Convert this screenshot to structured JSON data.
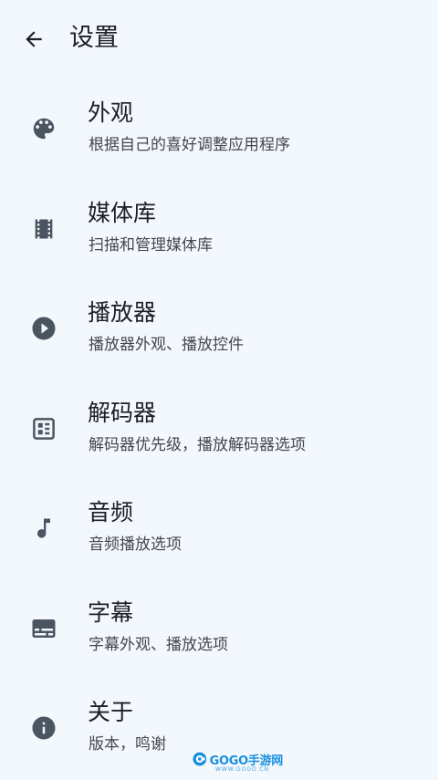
{
  "header": {
    "title": "设置",
    "back_icon": "arrow-back-icon"
  },
  "items": [
    {
      "title": "外观",
      "subtitle": "根据自己的喜好调整应用程序",
      "icon": "palette-icon"
    },
    {
      "title": "媒体库",
      "subtitle": "扫描和管理媒体库",
      "icon": "film-strip-icon"
    },
    {
      "title": "播放器",
      "subtitle": "播放器外观、播放控件",
      "icon": "play-circle-icon"
    },
    {
      "title": "解码器",
      "subtitle": "解码器优先级，播放解码器选项",
      "icon": "decoder-chip-icon"
    },
    {
      "title": "音频",
      "subtitle": "音频播放选项",
      "icon": "music-note-icon"
    },
    {
      "title": "字幕",
      "subtitle": "字幕外观、播放选项",
      "icon": "subtitles-icon"
    },
    {
      "title": "关于",
      "subtitle": "版本，鸣谢",
      "icon": "info-icon"
    }
  ],
  "watermark": {
    "text": "GOGO手游网",
    "sub": "WWW.GOGO.CN"
  },
  "colors": {
    "background": "#f3f8fd",
    "icon": "#4a5561",
    "title": "#1c1f24",
    "subtitle": "#44474e",
    "watermark": "#1a8fe0"
  }
}
